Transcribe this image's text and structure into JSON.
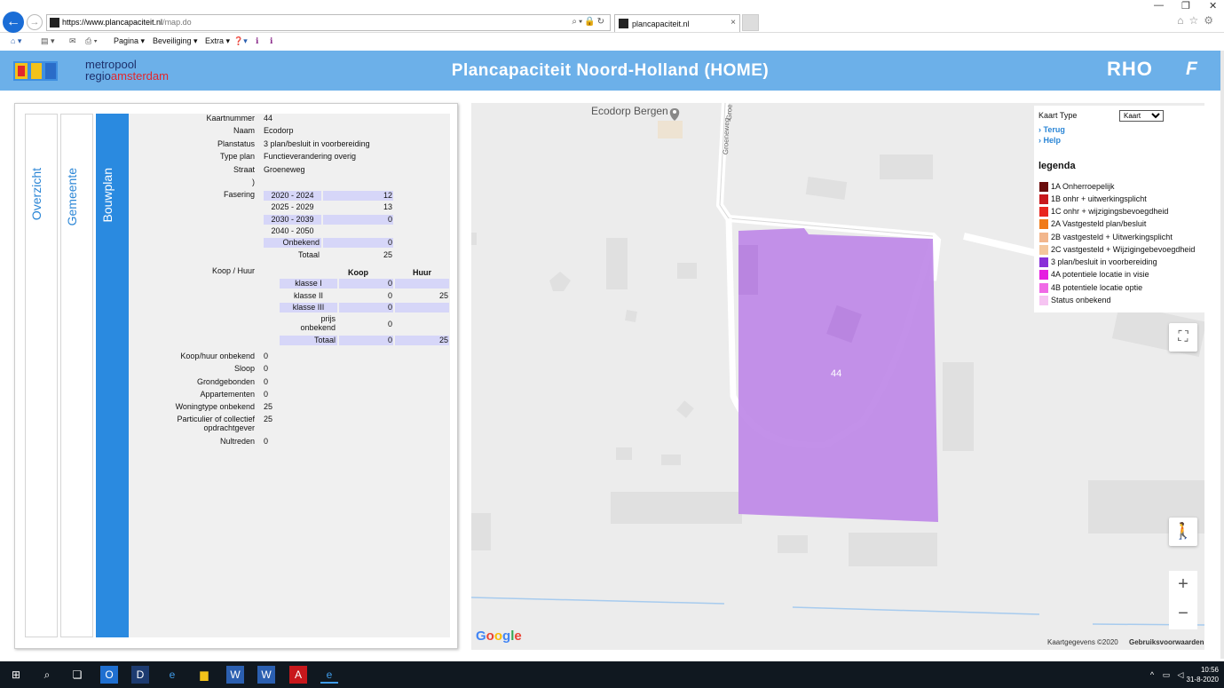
{
  "browser": {
    "url_host": "https://www.plancapaciteit.nl",
    "url_path": "/map.do",
    "tab_title": "plancapaciteit.nl",
    "tab_close": "×",
    "menu": [
      "Pagina ▾",
      "Beveiliging ▾",
      "Extra ▾",
      "❓▾"
    ]
  },
  "header": {
    "logo_line1": "metropool",
    "logo_line2a": "regio",
    "logo_line2b": "amsterdam",
    "title": "Plancapaciteit Noord-Holland (HOME)",
    "rho": "RHO",
    "f": "F"
  },
  "tabs": {
    "overzicht": "Overzicht",
    "gemeente": "Gemeente",
    "bouwplan": "Bouwplan"
  },
  "details": {
    "kaartnummer_label": "Kaartnummer",
    "kaartnummer": "44",
    "naam_label": "Naam",
    "naam": "Ecodorp",
    "planstatus_label": "Planstatus",
    "planstatus": "3 plan/besluit in voorbereiding",
    "typeplan_label": "Type plan",
    "typeplan": "Functieverandering overig",
    "straat_label": "Straat",
    "straat": "Groeneweg",
    "paren": ")",
    "fasering_label": "Fasering",
    "fasering": [
      {
        "period": "2020 - 2024",
        "value": "12"
      },
      {
        "period": "2025 - 2029",
        "value": "13"
      },
      {
        "period": "2030 - 2039",
        "value": "0"
      },
      {
        "period": "2040 - 2050",
        "value": ""
      },
      {
        "period": "Onbekend",
        "value": "0"
      },
      {
        "period": "Totaal",
        "value": "25"
      }
    ],
    "koophuur_label": "Koop / Huur",
    "koop_header": "Koop",
    "huur_header": "Huur",
    "koophuur": [
      {
        "klasse": "klasse I",
        "koop": "0",
        "huur": ""
      },
      {
        "klasse": "klasse II",
        "koop": "0",
        "huur": "25"
      },
      {
        "klasse": "klasse III",
        "koop": "0",
        "huur": ""
      },
      {
        "klasse": "prijs onbekend",
        "koop": "0",
        "huur": ""
      },
      {
        "klasse": "Totaal",
        "koop": "0",
        "huur": "25"
      }
    ],
    "extra": [
      {
        "label": "Koop/huur onbekend",
        "value": "0"
      },
      {
        "label": "Sloop",
        "value": "0"
      },
      {
        "label": "Grondgebonden",
        "value": "0"
      },
      {
        "label": "Appartementen",
        "value": "0"
      },
      {
        "label": "Woningtype onbekend",
        "value": "25"
      },
      {
        "label": "Particulier of collectief opdrachtgever",
        "value": "25"
      },
      {
        "label": "Nultreden",
        "value": "0"
      }
    ]
  },
  "map": {
    "poi": "Ecodorp Bergen",
    "road1": "Groeneweg",
    "road2": "Groe",
    "plan_label": "44",
    "google": "Google",
    "attrib1": "Kaartgegevens ©2020",
    "attrib2": "Gebruiksvoorwaarden",
    "plan_color": "#c08be8"
  },
  "legend": {
    "kaart_type_label": "Kaart Type",
    "kaart_type_value": "Kaart",
    "terug": "Terug",
    "help": "Help",
    "title": "legenda",
    "items": [
      {
        "label": "1A Onherroepelijk",
        "color": "#6b0c0c"
      },
      {
        "label": "1B onhr + uitwerkingsplicht",
        "color": "#c8181c"
      },
      {
        "label": "1C onhr + wijzigingsbevoegdheid",
        "color": "#e8261f"
      },
      {
        "label": "2A Vastgesteld plan/besluit",
        "color": "#f07a18"
      },
      {
        "label": "2B vastgesteld + Uitwerkingsplicht",
        "color": "#f2b68c"
      },
      {
        "label": "2C vastgesteld + Wijzigingebevoegdheid",
        "color": "#f4c69c"
      },
      {
        "label": "3 plan/besluit in voorbereiding",
        "color": "#8a2fd8"
      },
      {
        "label": "4A potentiele locatie in visie",
        "color": "#e51fe0"
      },
      {
        "label": "4B potentiele locatie optie",
        "color": "#f06ae6"
      },
      {
        "label": "Status onbekend",
        "color": "#f6c4f2"
      }
    ]
  },
  "taskbar": {
    "time": "10:56",
    "date": "31-8-2020"
  }
}
